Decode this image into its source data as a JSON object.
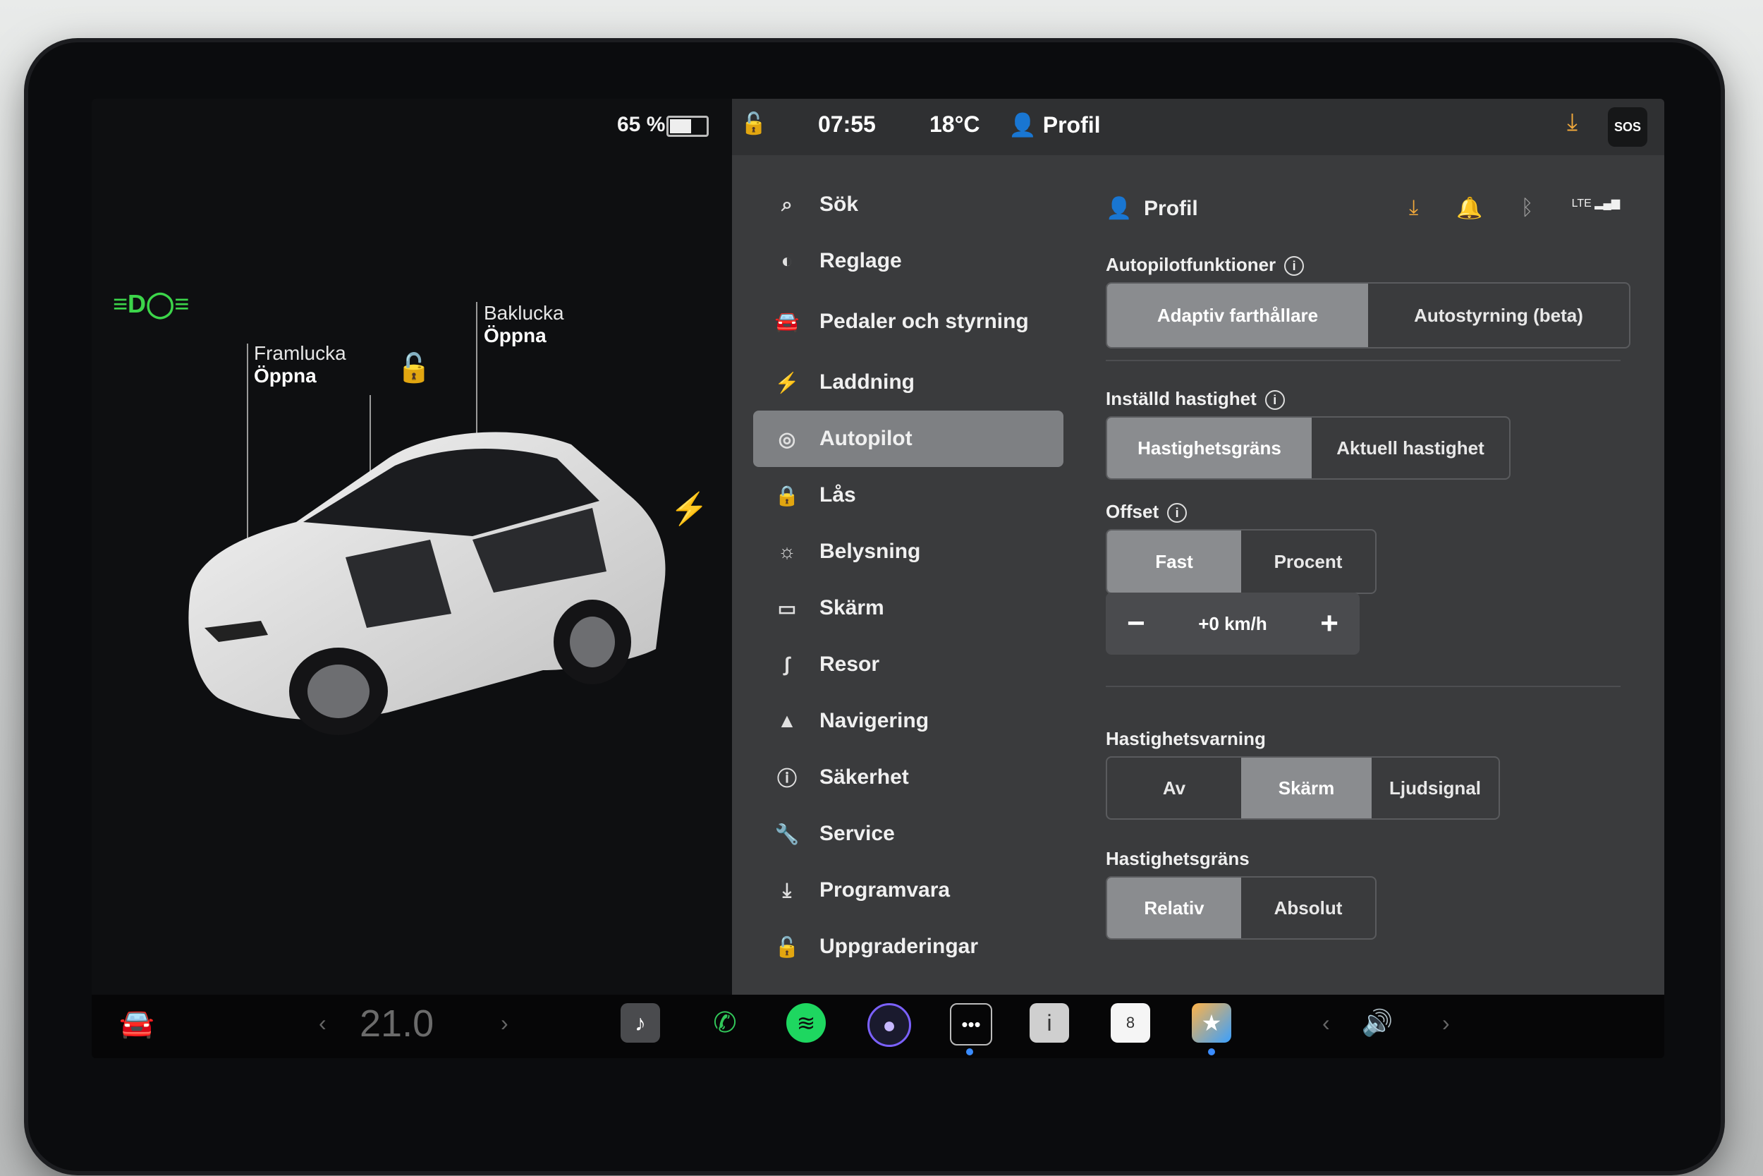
{
  "status": {
    "battery_percent": "65 %",
    "battery_level": 0.65,
    "time": "07:55",
    "temperature": "18°C",
    "profile": "Profil",
    "sos": "SOS"
  },
  "car_view": {
    "front_trunk_label": "Framlucka",
    "front_trunk_action": "Öppna",
    "rear_trunk_label": "Baklucka",
    "rear_trunk_action": "Öppna"
  },
  "menu": {
    "items": [
      {
        "label": "Sök",
        "icon": "search-icon"
      },
      {
        "label": "Reglage",
        "icon": "toggle-icon"
      },
      {
        "label": "Pedaler och styrning",
        "icon": "car-icon"
      },
      {
        "label": "Laddning",
        "icon": "bolt-icon"
      },
      {
        "label": "Autopilot",
        "icon": "steering-wheel-icon"
      },
      {
        "label": "Lås",
        "icon": "lock-icon"
      },
      {
        "label": "Belysning",
        "icon": "sun-icon"
      },
      {
        "label": "Skärm",
        "icon": "display-icon"
      },
      {
        "label": "Resor",
        "icon": "trips-icon"
      },
      {
        "label": "Navigering",
        "icon": "navigation-icon"
      },
      {
        "label": "Säkerhet",
        "icon": "safety-icon"
      },
      {
        "label": "Service",
        "icon": "wrench-icon"
      },
      {
        "label": "Programvara",
        "icon": "download-icon"
      },
      {
        "label": "Uppgraderingar",
        "icon": "bag-icon"
      }
    ]
  },
  "content": {
    "header_profile": "Profil",
    "lte": "LTE",
    "autopilot_features": {
      "title": "Autopilotfunktioner",
      "options": [
        "Adaptiv farthållare",
        "Autostyrning (beta)"
      ],
      "selected": 0
    },
    "set_speed": {
      "title": "Inställd hastighet",
      "options": [
        "Hastighetsgräns",
        "Aktuell hastighet"
      ],
      "selected": 0
    },
    "offset": {
      "title": "Offset",
      "options": [
        "Fast",
        "Procent"
      ],
      "selected": 0,
      "value": "+0 km/h",
      "minus": "−",
      "plus": "+"
    },
    "speed_warning": {
      "title": "Hastighetsvarning",
      "options": [
        "Av",
        "Skärm",
        "Ljudsignal"
      ],
      "selected": 1
    },
    "speed_limit": {
      "title": "Hastighetsgräns",
      "options": [
        "Relativ",
        "Absolut"
      ],
      "selected": 0
    }
  },
  "dock": {
    "cabin_temp": "21.0",
    "calendar_day": "8"
  }
}
